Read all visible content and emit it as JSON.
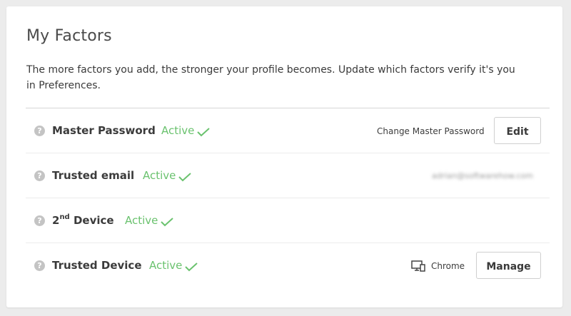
{
  "header": {
    "title": "My Factors",
    "description": "The more factors you add, the stronger your profile becomes. Update which factors verify it's you in Preferences."
  },
  "colors": {
    "active": "#6ac26e",
    "help_icon": "#c4c4c4"
  },
  "factors": [
    {
      "name": "Master Password",
      "status": "Active",
      "aside": "Change Master Password",
      "button": "Edit"
    },
    {
      "name": "Trusted email",
      "status": "Active",
      "aside": "adrian@softwarehow.com"
    },
    {
      "name_main": "2",
      "name_sup": "nd",
      "name_rest": " Device",
      "status": "Active"
    },
    {
      "name": "Trusted Device",
      "status": "Active",
      "browser": "Chrome",
      "button": "Manage",
      "device_icon": "monitor-phone-icon"
    }
  ]
}
